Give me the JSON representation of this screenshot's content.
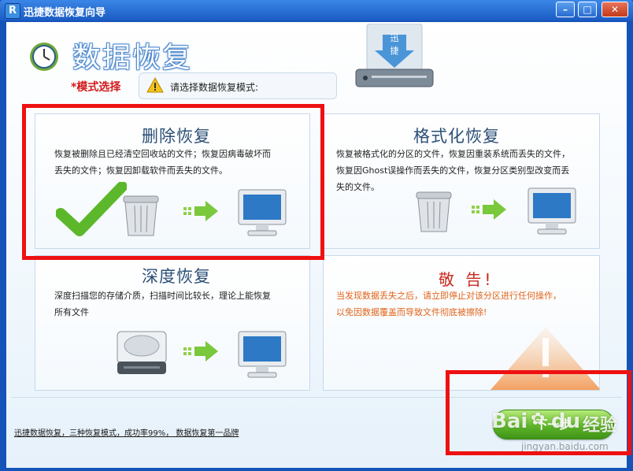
{
  "window": {
    "title": "迅捷数据恢复向导",
    "app_icon_letter": "R",
    "controls": {
      "minimize": "–",
      "maximize": "□",
      "close": "✕"
    }
  },
  "header": {
    "title": "数据恢复",
    "mode_label": "*模式选择",
    "prompt": "请选择数据恢复模式:",
    "drive_label_1": "迅",
    "drive_label_2": "捷"
  },
  "modes": [
    {
      "title": "删除恢复",
      "desc_1": "恢复被删除且已经清空回收站的文件；恢复因病毒破坏而",
      "desc_2": "丢失的文件；恢复因卸载软件而丢失的文件。"
    },
    {
      "title": "格式化恢复",
      "desc_1": "恢复被格式化的分区的文件，恢复因重装系统而丢失的文件，",
      "desc_2": "恢复因Ghost误操作而丢失的文件，恢复分区类别型改变而丢",
      "desc_3": "失的文件。"
    },
    {
      "title": "深度恢复",
      "desc_1": "深度扫描您的存储介质，扫描时间比较长，理论上能恢复",
      "desc_2": "所有文件"
    }
  ],
  "warning": {
    "title": "敬 告!",
    "line_1": "当发现数据丢失之后，请立即停止对该分区进行任何操作，",
    "line_2": "以免因数据覆盖而导致文件彻底被擦除!"
  },
  "footer": {
    "status": "迅捷数据恢复，三种恢复模式，成功率99%， 数据恢复第一品牌",
    "next_label": "下一步"
  },
  "watermark": {
    "logo_a": "Bai",
    "logo_b": "du",
    "logo_c": "经验",
    "url": "jingyan.baidu.com"
  },
  "colors": {
    "accent_red": "#ee1111",
    "title_blue": "#2b4f75",
    "warning_orange": "#e2641a",
    "button_green": "#5fb52a"
  },
  "icons": [
    "clock-icon",
    "warning-triangle-icon",
    "hard-drive-icon",
    "check-icon",
    "recycle-bin-icon",
    "arrow-right-icon",
    "monitor-icon",
    "hdd-icon",
    "exclamation-icon"
  ]
}
